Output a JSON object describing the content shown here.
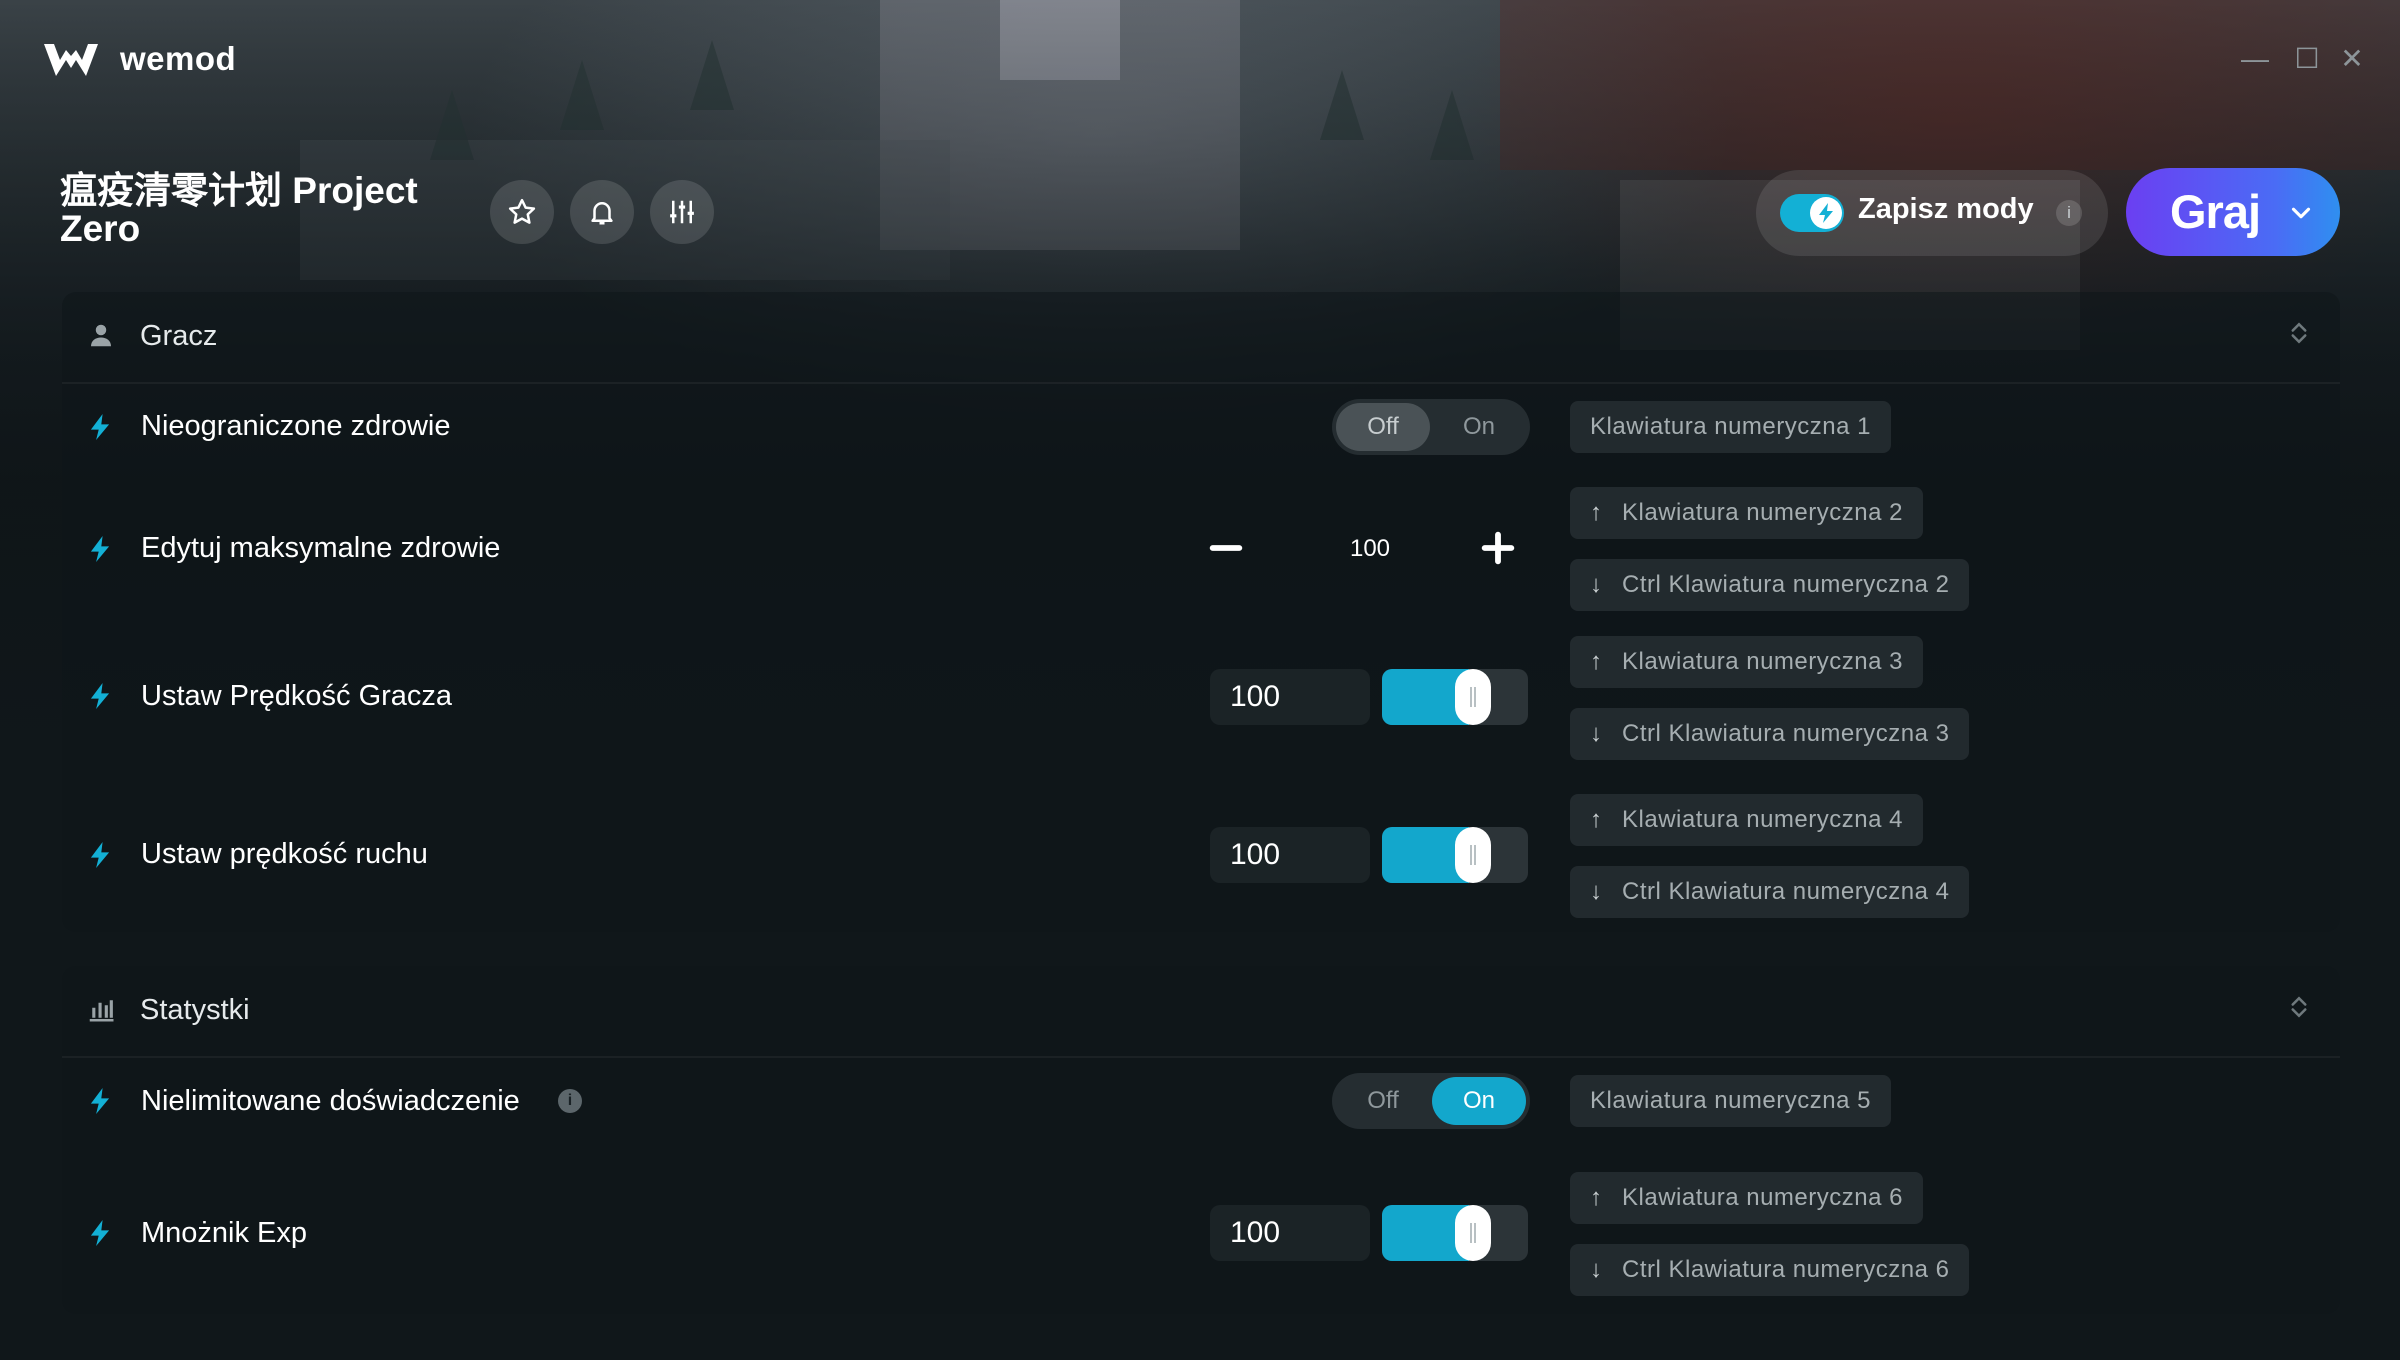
{
  "app": {
    "brand": "wemod",
    "window_controls": {
      "minimize": "—",
      "maximize": "☐",
      "close": "✕"
    }
  },
  "header": {
    "game_title": "瘟疫清零计划 Project Zero",
    "save_mods_label": "Zapisz mody",
    "save_mods_enabled": true,
    "info_glyph": "i",
    "play_label": "Graj"
  },
  "sections": {
    "player": {
      "title": "Gracz",
      "icon": "person-icon",
      "rows": {
        "health": {
          "name": "Nieograniczone zdrowie",
          "off": "Off",
          "on": "On",
          "state": "Off",
          "hotkey": "Klawiatura numeryczna 1"
        },
        "max_health": {
          "name": "Edytuj maksymalne zdrowie",
          "value": "100",
          "hotkey_up": "Klawiatura numeryczna 2",
          "hotkey_down": "Ctrl Klawiatura numeryczna 2"
        },
        "player_speed": {
          "name": "Ustaw Prędkość Gracza",
          "value": "100",
          "level": 0.5,
          "hotkey_up": "Klawiatura numeryczna 3",
          "hotkey_down": "Ctrl Klawiatura numeryczna 3"
        },
        "move_speed": {
          "name": "Ustaw prędkość ruchu",
          "value": "100",
          "level": 0.5,
          "hotkey_up": "Klawiatura numeryczna 4",
          "hotkey_down": "Ctrl Klawiatura numeryczna 4"
        }
      }
    },
    "stats": {
      "title": "Statystki",
      "icon": "bar-chart-icon",
      "rows": {
        "experience": {
          "name": "Nielimitowane doświadczenie",
          "off": "Off",
          "on": "On",
          "state": "On",
          "hotkey": "Klawiatura numeryczna 5"
        },
        "exp_mult": {
          "name": "Mnożnik Exp",
          "value": "100",
          "level": 0.5,
          "hotkey_up": "Klawiatura numeryczna 6",
          "hotkey_down": "Ctrl Klawiatura numeryczna 6"
        }
      }
    }
  },
  "glyphs": {
    "arrow_up": "↑",
    "arrow_down": "↓"
  },
  "colors": {
    "accent": "#13a7cc",
    "play_start": "#6b3ff2",
    "play_end": "#2f8ff0",
    "bolt": "#13b0d5"
  }
}
